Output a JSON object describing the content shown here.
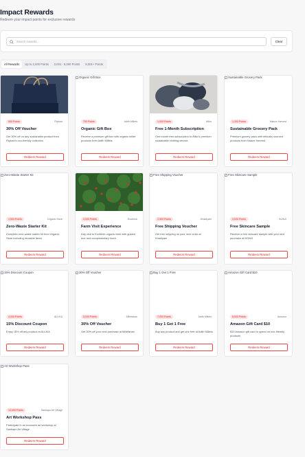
{
  "header": {
    "title": "Impact Rewards",
    "subtitle": "Redeem your impact points for exclusive rewards"
  },
  "search": {
    "placeholder": "Search rewards...",
    "value": "",
    "clear_label": "Clear"
  },
  "filters": [
    {
      "label": "All Rewards",
      "active": true
    },
    {
      "label": "Up to 2,000 Points",
      "active": false
    },
    {
      "label": "2,001 - 5,000 Points",
      "active": false
    },
    {
      "label": "5,001+ Points",
      "active": false
    }
  ],
  "redeem_label": "Redeem Reward",
  "rewards": [
    {
      "image_alt": "",
      "image": "bag-photo",
      "points": "500 Points",
      "brand": "Flipkart",
      "title": "30% Off Voucher",
      "description": "Get 30% off on any sustainable product from Flipkart's eco-friendly collection"
    },
    {
      "image_alt": "Organic Gift Box",
      "image": "broken-image-icon",
      "points": "750 Points",
      "brand": "Adith Millets",
      "title": "Organic Gift Box",
      "description": "Receive a premium gift box with organic millet products from Adith Millets"
    },
    {
      "image_alt": "",
      "image": "clothing-photo",
      "points": "1,000 Points",
      "brand": "Afiko",
      "title": "Free 1-Month Subscription",
      "description": "One month free subscription to Afiko's premium sustainable clothing service"
    },
    {
      "image_alt": "Sustainable Grocery Pack",
      "image": "broken-image-icon",
      "points": "1,200 Points",
      "brand": "Nature Harvest",
      "title": "Sustainable Grocery Pack",
      "description": "Premium grocery pack with ethically sourced products from Nature Harvest"
    },
    {
      "image_alt": "Zero-Waste Starter Kit",
      "image": "broken-image-icon",
      "points": "1,500 Points",
      "brand": "Organic Store",
      "title": "Zero-Waste Starter Kit",
      "description": "Complete zero-waste starter kit from Organic Store including reusable items"
    },
    {
      "image_alt": "",
      "image": "farm-photo",
      "points": "2,000 Points",
      "brand": "Ecofresh",
      "title": "Farm Visit Experience",
      "description": "Day visit to Ecofresh organic farm with guided tour and complimentary lunch"
    },
    {
      "image_alt": "Free Shipping Voucher",
      "image": "broken-image-icon",
      "points": "2,500 Points",
      "brand": "Khadiyam",
      "title": "Free Shipping Voucher",
      "description": "Get free shipping on your next order at Khadiyam"
    },
    {
      "image_alt": "Free Skincare Sample",
      "image": "broken-image-icon",
      "points": "3,000 Points",
      "brand": "BONJI",
      "title": "Free Skincare Sample",
      "description": "Receive a free skincare sample with your next purchase at BONJI"
    },
    {
      "image_alt": "15% Discount Coupon",
      "image": "broken-image-icon",
      "points": "4,000 Points",
      "brand": "ALLIKA",
      "title": "15% Discount Coupon",
      "description": "Enjoy 15% off any product at ALLIKA"
    },
    {
      "image_alt": "30% Off Voucher",
      "image": "broken-image-icon",
      "points": "5,000 Points",
      "brand": "Milletarian",
      "title": "30% Off Voucher",
      "description": "Get 30% off your next purchase at Milletarian"
    },
    {
      "image_alt": "Buy 1 Get 1 Free",
      "image": "broken-image-icon",
      "points": "7,000 Points",
      "brand": "Adith Millets",
      "title": "Buy 1 Get 1 Free",
      "description": "Buy any product and get one free at Adith Millets"
    },
    {
      "image_alt": "Amazon Gift Card $10",
      "image": "broken-image-icon",
      "points": "8,000 Points",
      "brand": "Amazon",
      "title": "Amazon Gift Card $10",
      "description": "$10 Amazon gift card to spend on eco-friendly products"
    },
    {
      "image_alt": "Art Workshop Pass",
      "image": "broken-image-icon",
      "points": "10,000 Points",
      "brand": "Sankapo Art Village",
      "title": "Art Workshop Pass",
      "description": "Participate in an exclusive art workshop at Sankapo Art Village"
    }
  ],
  "colors": {
    "accent": "#dc2626",
    "badge_bg": "#fee2e2",
    "border": "#e5e7eb"
  }
}
